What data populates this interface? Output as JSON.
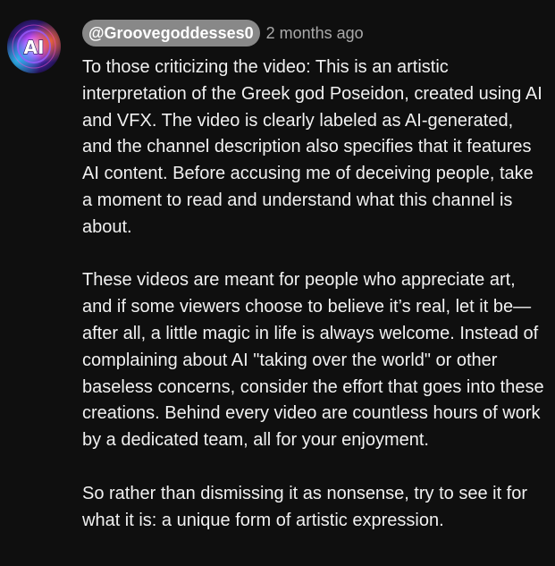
{
  "comment": {
    "avatar_icon": "ai-avatar-icon",
    "avatar_text": "AI",
    "author": "@Groovegoddesses0",
    "timestamp": "2 months ago",
    "paragraphs": [
      "To those criticizing the video: This is an artistic interpretation of the Greek god Poseidon, created using AI and VFX. The video is clearly labeled as AI-generated, and the channel description also specifies that it features AI content. Before accusing me of deceiving people, take a moment to read and understand what this channel is about.",
      "These videos are meant for people who appreciate art, and if some viewers choose to believe it’s real, let it be—after all, a little magic in life is always welcome. Instead of complaining about AI \"taking over the world\" or other baseless concerns, consider the effort that goes into these creations. Behind every video are countless hours of work by a dedicated team, all for your enjoyment.",
      "So rather than dismissing it as nonsense, try to see it for what it is: a unique form of artistic expression."
    ]
  },
  "colors": {
    "background": "#0f0f0f",
    "text": "#f1f1f1",
    "author_chip": "#888888",
    "timestamp": "#aaaaaa"
  }
}
